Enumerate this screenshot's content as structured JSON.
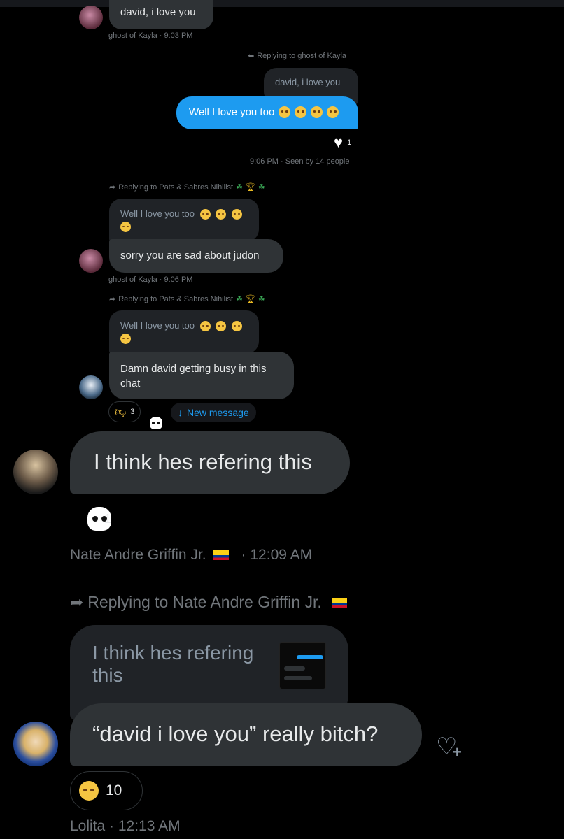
{
  "messages": [
    {
      "text": "david, i love you",
      "meta": "ghost of Kayla · 9:03 PM"
    },
    {
      "reply_label": "Replying to ghost of Kayla",
      "quote": "david, i love you",
      "text": "Well I love you too",
      "reaction_count": "1",
      "meta": "9:06 PM · Seen by 14 people"
    },
    {
      "reply_label": "Replying to Pats & Sabres Nihilist",
      "quote": "Well I love you too",
      "text": "sorry you are sad about judon",
      "meta": "ghost of Kayla · 9:06 PM"
    },
    {
      "reply_label": "Replying to Pats & Sabres Nihilist",
      "quote": "Well I love you too",
      "text": "Damn david getting busy in this chat",
      "reaction_count": "3",
      "new_message": "New message"
    },
    {
      "text": "I think hes refering this",
      "reaction_count": "1",
      "meta_name": "Nate Andre Griffin Jr.",
      "meta_time": "· 12:09 AM"
    },
    {
      "reply_label": "Replying to Nate Andre Griffin Jr.",
      "quote": "I think hes refering this",
      "text": "“david i love you” really bitch?",
      "reaction_count": "10",
      "meta": "Lolita · 12:13 AM"
    }
  ],
  "colors": {
    "accent": "#1d9bf0",
    "bubble": "#2f3336",
    "background": "#000000",
    "muted": "#71767b"
  }
}
